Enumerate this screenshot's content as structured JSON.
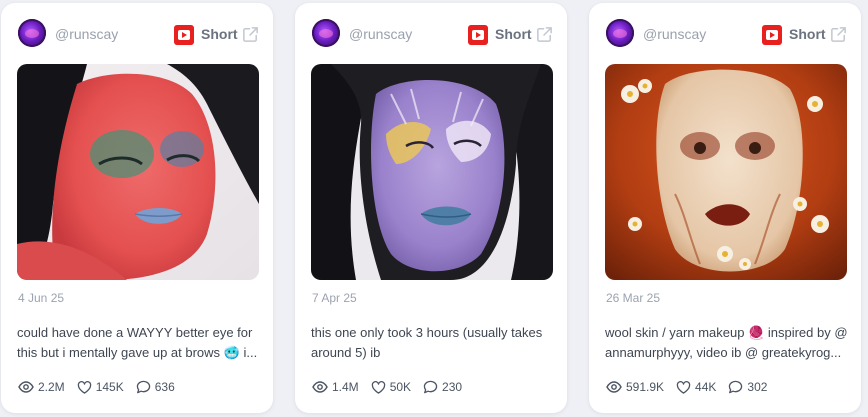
{
  "cards": [
    {
      "username": "@runscay",
      "platform": "Short",
      "date": "4 Jun 25",
      "caption": "could have done a WAYYY better eye for this but i mentally gave up at brows 🥶 i...",
      "views": "2.2M",
      "likes": "145K",
      "comments": "636"
    },
    {
      "username": "@runscay",
      "platform": "Short",
      "date": "7 Apr 25",
      "caption": "this one only took 3 hours (usually takes around 5) ib",
      "views": "1.4M",
      "likes": "50K",
      "comments": "230"
    },
    {
      "username": "@runscay",
      "platform": "Short",
      "date": "26 Mar 25",
      "caption": "wool skin / yarn makeup 🧶 inspired by @ annamurphyyy, video ib @ greatekyrog...",
      "views": "591.9K",
      "likes": "44K",
      "comments": "302"
    }
  ],
  "colors": {
    "platform_red": "#e8201f",
    "muted_text": "#9aa1ad",
    "body_text": "#3f4652"
  },
  "icons": {
    "platform": "youtube-icon",
    "open": "external-link-icon",
    "views": "eye-icon",
    "likes": "heart-icon",
    "comments": "comment-icon"
  }
}
